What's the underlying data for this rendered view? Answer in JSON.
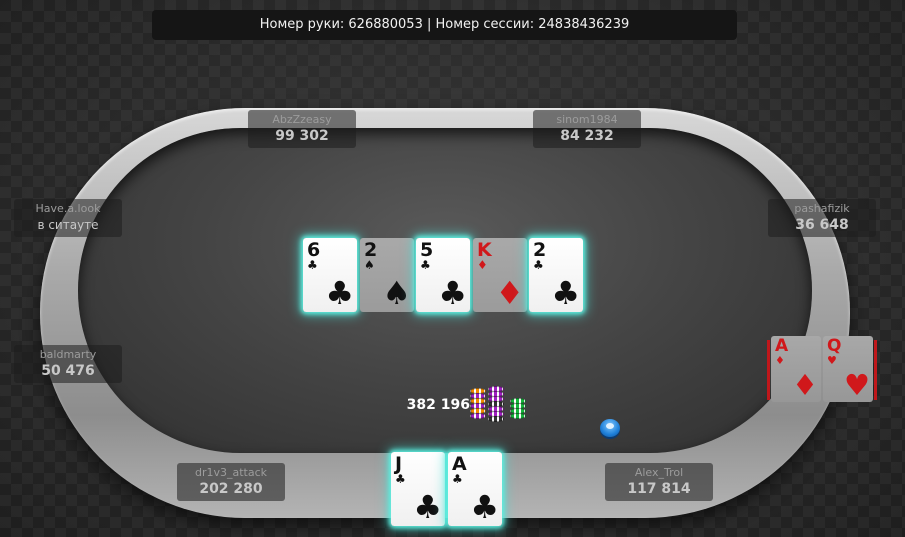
{
  "header": {
    "text": "Номер руки: 626880053 | Номер сессии: 24838436239"
  },
  "seats": [
    {
      "id": "abzzzeasy",
      "name": "AbzZzeasy",
      "stack": "99 302"
    },
    {
      "id": "sinom1984",
      "name": "sinom1984",
      "stack": "84 232"
    },
    {
      "id": "have-a-look",
      "name": "Have.a.look",
      "status": "в ситауте"
    },
    {
      "id": "pashafizik",
      "name": "pashafizik",
      "stack": "36 648"
    },
    {
      "id": "baldmarty",
      "name": "baldmarty",
      "stack": "50 476"
    },
    {
      "id": "dr1v3-attack",
      "name": "dr1v3_attack",
      "stack": "202 280"
    },
    {
      "id": "alex-trol",
      "name": "Alex_Trol",
      "stack": "117 814"
    }
  ],
  "board": [
    {
      "rank": "6",
      "suit": "♣",
      "color": "black",
      "highlight": true
    },
    {
      "rank": "2",
      "suit": "♠",
      "color": "black",
      "highlight": false
    },
    {
      "rank": "5",
      "suit": "♣",
      "color": "black",
      "highlight": true
    },
    {
      "rank": "K",
      "suit": "♦",
      "color": "red",
      "highlight": false
    },
    {
      "rank": "2",
      "suit": "♣",
      "color": "black",
      "highlight": true
    }
  ],
  "hero_cards": [
    {
      "rank": "J",
      "suit": "♣",
      "color": "black"
    },
    {
      "rank": "A",
      "suit": "♣",
      "color": "black"
    }
  ],
  "villain_cards": [
    {
      "rank": "A",
      "suit": "♦",
      "color": "red"
    },
    {
      "rank": "Q",
      "suit": "♥",
      "color": "red"
    }
  ],
  "pot": {
    "amount": "382 196"
  },
  "colors": {
    "highlight_glow": "#5ff0e0",
    "red_suit": "#d0181b",
    "dealer_button": "#1e7fd8"
  }
}
